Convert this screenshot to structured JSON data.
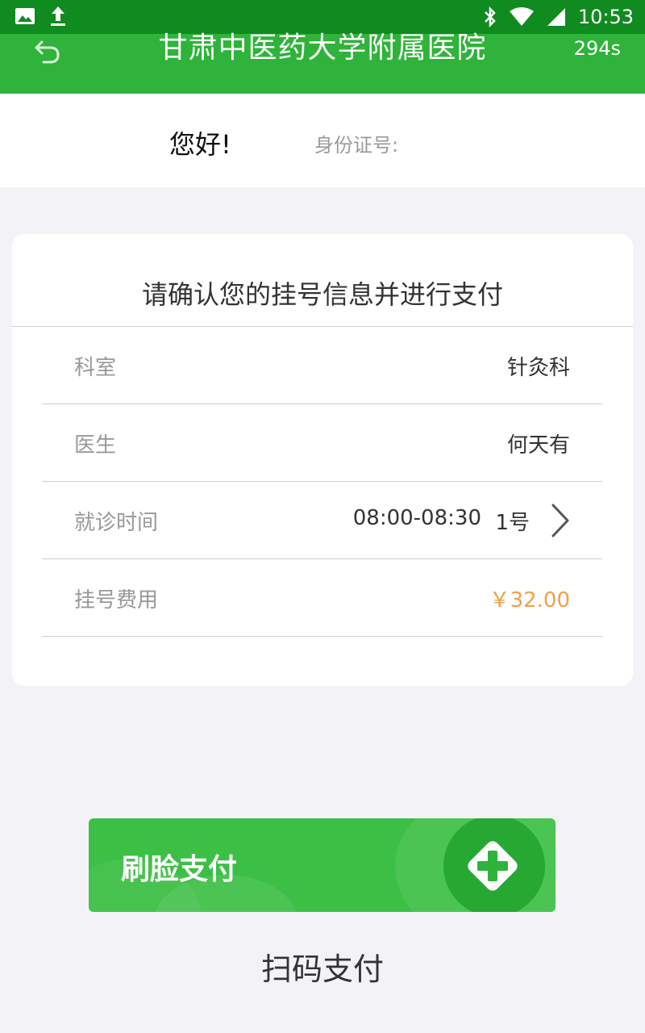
{
  "status_bar": {
    "time": "10:53",
    "left_icons": [
      "image-icon",
      "upload-icon"
    ],
    "right_icons": [
      "bluetooth-icon",
      "wifi-icon",
      "signal-icon"
    ]
  },
  "header": {
    "title": "甘肃中医药大学附属医院",
    "countdown": "294s",
    "back_icon": "back-arrow-icon"
  },
  "user": {
    "greeting": "您好!",
    "id_label": "身份证号:"
  },
  "card": {
    "title": "请确认您的挂号信息并进行支付",
    "rows": {
      "department": {
        "label": "科室",
        "value": "针灸科"
      },
      "doctor": {
        "label": "医生",
        "value": "何天有"
      },
      "visit_time": {
        "label": "就诊时间",
        "time": "08:00-08:30",
        "number": "1号"
      },
      "fee": {
        "label": "挂号费用",
        "value": "￥32.00"
      }
    }
  },
  "actions": {
    "face_pay": "刷脸支付",
    "scan_pay": "扫码支付"
  },
  "colors": {
    "status_bar": "#0f8b1f",
    "header": "#2fb33a",
    "face_pay_button": "#3cbf45",
    "price": "#f0a04b"
  }
}
